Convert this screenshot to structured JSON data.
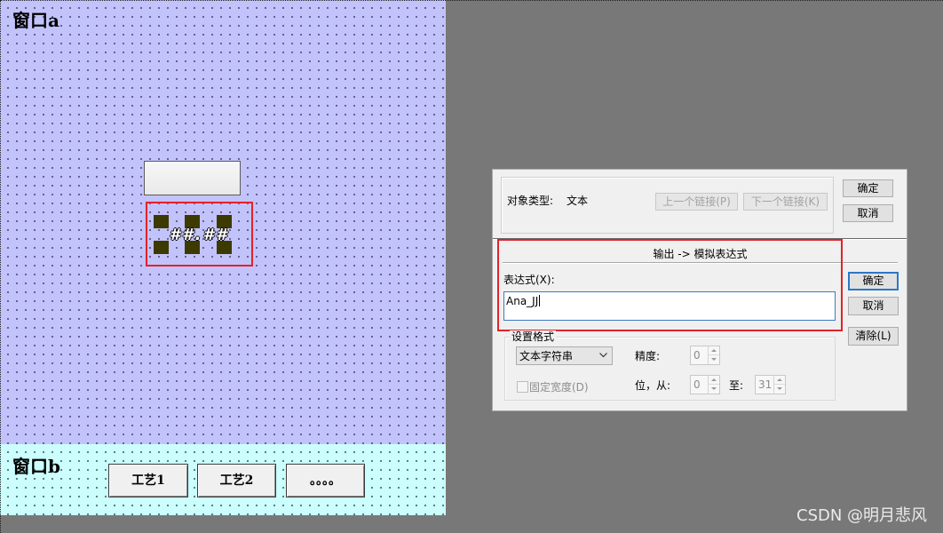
{
  "colors": {
    "workspace_bg": "#787878",
    "window_a_bg": "#c3c3fb",
    "window_b_bg": "#ccfefe",
    "highlight_red": "#e0232b",
    "selection_handle": "#3d3a00",
    "default_button_border": "#2b78c6"
  },
  "icons": {
    "format_select": "chevron-down-icon",
    "spinner_up": "spin-up-icon",
    "spinner_down": "spin-down-icon"
  },
  "window_a": {
    "label": "窗口a",
    "text_object": "##.##"
  },
  "window_b": {
    "label": "窗口b",
    "buttons": [
      "工艺1",
      "工艺2",
      "。。。。"
    ]
  },
  "dialog": {
    "object_type_label": "对象类型:",
    "object_type_value": "文本",
    "prev_link_label": "上一个链接(P)",
    "next_link_label": "下一个链接(K)",
    "top_ok_label": "确定",
    "top_cancel_label": "取消",
    "section_title": "输出 -> 模拟表达式",
    "expression": {
      "label": "表达式(X):",
      "value": "Ana_JJ"
    },
    "ok_label": "确定",
    "cancel_label": "取消",
    "clear_label": "清除(L)",
    "format": {
      "group_label": "设置格式",
      "selected_option": "文本字符串",
      "precision_label": "精度:",
      "precision_value": "0",
      "fixed_width_label": "固定宽度(D)",
      "fixed_width_checked": false,
      "digits_from_label": "位，从:",
      "digits_from_value": "0",
      "to_label": "至:",
      "to_value": "31"
    }
  },
  "watermark": "CSDN @明月悲风"
}
